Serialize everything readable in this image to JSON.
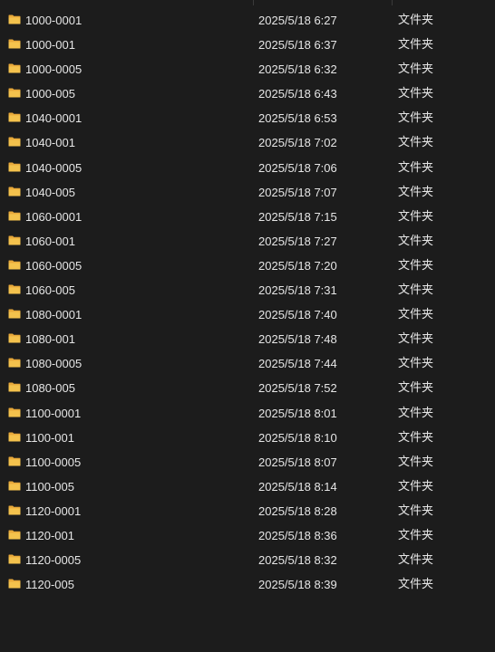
{
  "colors": {
    "background": "#1c1c1c",
    "text": "#e6e6e6",
    "folder": "#f4c24d"
  },
  "rows": [
    {
      "name": "1000-0001",
      "modified": "2025/5/18 6:27",
      "type": "文件夹"
    },
    {
      "name": "1000-001",
      "modified": "2025/5/18 6:37",
      "type": "文件夹"
    },
    {
      "name": "1000-0005",
      "modified": "2025/5/18 6:32",
      "type": "文件夹"
    },
    {
      "name": "1000-005",
      "modified": "2025/5/18 6:43",
      "type": "文件夹"
    },
    {
      "name": "1040-0001",
      "modified": "2025/5/18 6:53",
      "type": "文件夹"
    },
    {
      "name": "1040-001",
      "modified": "2025/5/18 7:02",
      "type": "文件夹"
    },
    {
      "name": "1040-0005",
      "modified": "2025/5/18 7:06",
      "type": "文件夹"
    },
    {
      "name": "1040-005",
      "modified": "2025/5/18 7:07",
      "type": "文件夹"
    },
    {
      "name": "1060-0001",
      "modified": "2025/5/18 7:15",
      "type": "文件夹"
    },
    {
      "name": "1060-001",
      "modified": "2025/5/18 7:27",
      "type": "文件夹"
    },
    {
      "name": "1060-0005",
      "modified": "2025/5/18 7:20",
      "type": "文件夹"
    },
    {
      "name": "1060-005",
      "modified": "2025/5/18 7:31",
      "type": "文件夹"
    },
    {
      "name": "1080-0001",
      "modified": "2025/5/18 7:40",
      "type": "文件夹"
    },
    {
      "name": "1080-001",
      "modified": "2025/5/18 7:48",
      "type": "文件夹"
    },
    {
      "name": "1080-0005",
      "modified": "2025/5/18 7:44",
      "type": "文件夹"
    },
    {
      "name": "1080-005",
      "modified": "2025/5/18 7:52",
      "type": "文件夹"
    },
    {
      "name": "1100-0001",
      "modified": "2025/5/18 8:01",
      "type": "文件夹"
    },
    {
      "name": "1100-001",
      "modified": "2025/5/18 8:10",
      "type": "文件夹"
    },
    {
      "name": "1100-0005",
      "modified": "2025/5/18 8:07",
      "type": "文件夹"
    },
    {
      "name": "1100-005",
      "modified": "2025/5/18 8:14",
      "type": "文件夹"
    },
    {
      "name": "1120-0001",
      "modified": "2025/5/18 8:28",
      "type": "文件夹"
    },
    {
      "name": "1120-001",
      "modified": "2025/5/18 8:36",
      "type": "文件夹"
    },
    {
      "name": "1120-0005",
      "modified": "2025/5/18 8:32",
      "type": "文件夹"
    },
    {
      "name": "1120-005",
      "modified": "2025/5/18 8:39",
      "type": "文件夹"
    }
  ]
}
